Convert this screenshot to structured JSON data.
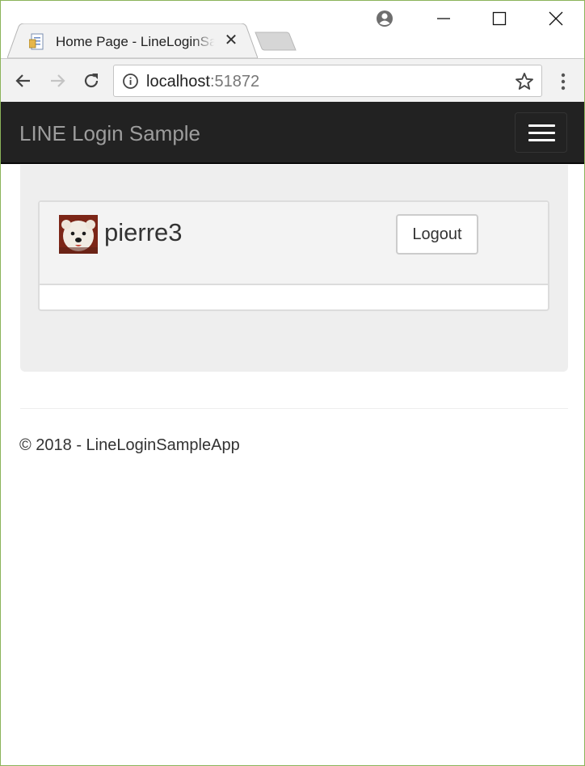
{
  "browser": {
    "tab": {
      "title": "Home Page - LineLoginSampleApp",
      "close_glyph": "✕",
      "favicon": "page-icon"
    },
    "window_controls": {
      "minimize": "minimize-icon",
      "maximize": "maximize-icon",
      "close": "close-icon"
    },
    "address_bar": {
      "host": "localhost",
      "port": ":51872"
    },
    "toolbar_icons": [
      "back-icon",
      "forward-icon",
      "reload-icon",
      "info-icon",
      "star-icon",
      "more-vert-icon",
      "profile-icon"
    ]
  },
  "page": {
    "navbar": {
      "brand": "LINE Login Sample",
      "toggle": "hamburger-icon"
    },
    "user_panel": {
      "username": "pierre3",
      "logout_label": "Logout"
    },
    "footer": {
      "text": "© 2018 - LineLoginSampleApp"
    }
  },
  "colors": {
    "navbar_bg": "#222222",
    "brand": "#9d9d9d",
    "jumbotron_bg": "#eeeeee",
    "window_border": "#8bb35a"
  }
}
